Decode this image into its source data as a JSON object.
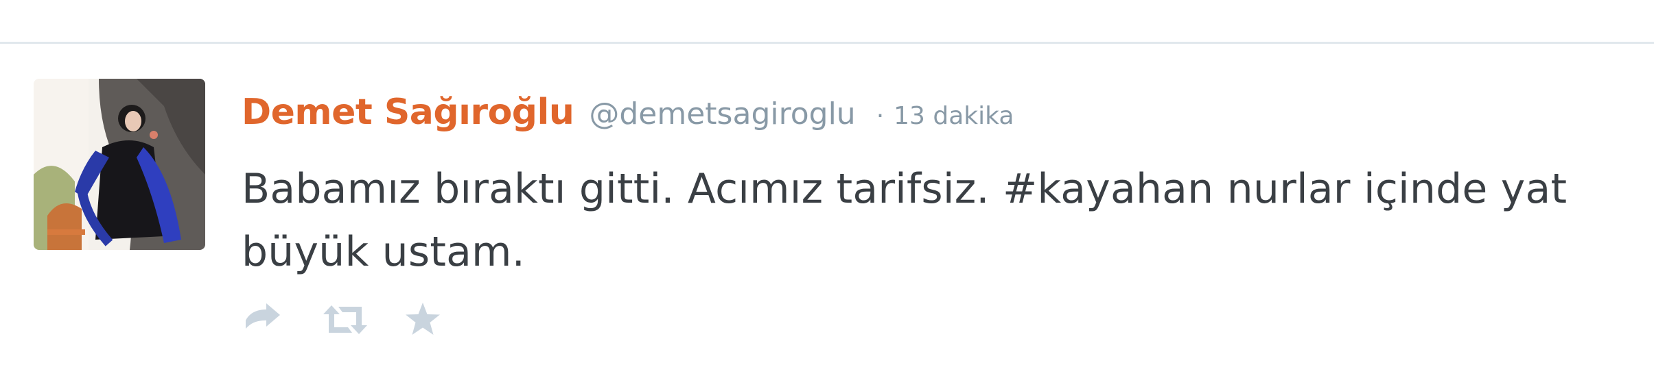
{
  "tweet": {
    "author_name": "Demet Sağıroğlu",
    "handle": "@demetsagiroglu",
    "separator": "·",
    "time": "13 dakika",
    "text": "Babamız bıraktı gitti. Acımız tarifsiz. #kayahan nurlar içinde yat büyük ustam."
  },
  "actions": [
    {
      "icon": "reply-icon"
    },
    {
      "icon": "retweet-icon"
    },
    {
      "icon": "favorite-star-icon"
    }
  ],
  "colors": {
    "author_name": "#e0662c",
    "meta": "#8899a6",
    "text": "#3a3f44",
    "action_icons": "#c9d4de",
    "divider": "#e1e8ed"
  }
}
